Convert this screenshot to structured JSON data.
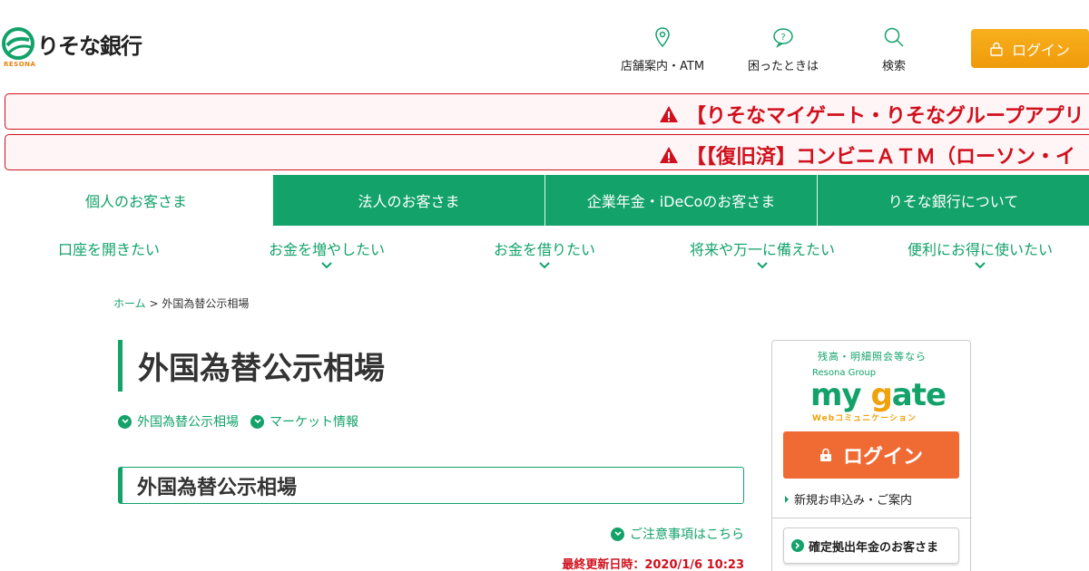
{
  "header": {
    "logo": {
      "name": "りそな銀行",
      "sub": "RESONA"
    },
    "nav": [
      {
        "label": "店舗案内・ATM",
        "icon": "location-pin-icon"
      },
      {
        "label": "困ったときは",
        "icon": "help-bubble-icon"
      },
      {
        "label": "検索",
        "icon": "search-icon"
      }
    ],
    "login_label": "ログイン"
  },
  "alerts": [
    {
      "text": "【りそなマイゲート・りそなグループアプリ"
    },
    {
      "text": "【【復旧済】コンビニＡＴＭ（ローソン・イ"
    }
  ],
  "tabs": [
    {
      "label": "個人のお客さま",
      "active": true
    },
    {
      "label": "法人のお客さま"
    },
    {
      "label": "企業年金・iDeCoのお客さま"
    },
    {
      "label": "りそな銀行について"
    }
  ],
  "submenu": [
    {
      "label": "口座を開きたい",
      "has_dropdown": false
    },
    {
      "label": "お金を増やしたい",
      "has_dropdown": true
    },
    {
      "label": "お金を借りたい",
      "has_dropdown": true
    },
    {
      "label": "将来や万一に備えたい",
      "has_dropdown": true
    },
    {
      "label": "便利にお得に使いたい",
      "has_dropdown": true
    }
  ],
  "breadcrumb": {
    "home": "ホーム",
    "sep": ">",
    "current": "外国為替公示相場"
  },
  "page_title": "外国為替公示相場",
  "anchors": [
    "外国為替公示相場",
    "マーケット情報"
  ],
  "section_title": "外国為替公示相場",
  "notice_link": "ご注意事項はこちら",
  "updated": "最終更新日時：2020/1/6 10:23",
  "side_card": {
    "caption": "残高・明細照会等なら",
    "group": "Resona Group",
    "brand_my": "my ",
    "brand_g": "g",
    "brand_rest": "ate",
    "brand_sub": "Webコミュニケーション",
    "login": "ログイン",
    "signup": "新規お申込み・ご案内",
    "pension": "確定拠出年金のお客さま"
  },
  "colors": {
    "brand_green": "#12a26a",
    "alert_red": "#d0101c",
    "login_orange": "#f06a34",
    "header_login": "#f09a0b"
  }
}
